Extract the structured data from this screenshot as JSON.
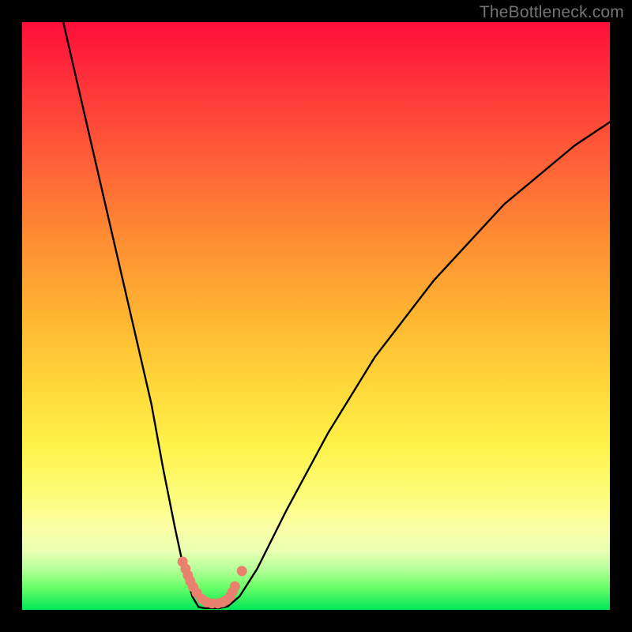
{
  "watermark": "TheBottleneck.com",
  "chart_data": {
    "type": "line",
    "title": "",
    "xlabel": "",
    "ylabel": "",
    "xlim": [
      0,
      100
    ],
    "ylim": [
      0,
      100
    ],
    "grid": false,
    "legend": false,
    "background_gradient": {
      "top": "#ff0e3a",
      "mid": "#ffd83a",
      "bottom": "#00e756"
    },
    "series": [
      {
        "name": "bottleneck-curve",
        "stroke": "#000000",
        "x": [
          7,
          10,
          13,
          16,
          19,
          22,
          24,
          26,
          27.5,
          29,
          30,
          31,
          33.5,
          35,
          37,
          40,
          45,
          52,
          60,
          70,
          82,
          94,
          100
        ],
        "values": [
          100,
          87,
          74,
          61,
          48,
          35,
          24,
          14,
          7,
          2.2,
          0.5,
          0.3,
          0.3,
          0.6,
          2.3,
          7,
          17,
          30,
          43,
          56,
          69,
          79,
          83
        ]
      },
      {
        "name": "marker-dots",
        "stroke": "#e9816f",
        "type": "scatter",
        "x": [
          27.3,
          27.8,
          28.2,
          28.6,
          29.1,
          29.7,
          30.5,
          31.4,
          32.3,
          33.3,
          34.1,
          34.8,
          35.4,
          35.8,
          36.2,
          37.4
        ],
        "values": [
          8.2,
          7.0,
          5.9,
          4.9,
          3.9,
          2.9,
          1.9,
          1.3,
          1.1,
          1.1,
          1.3,
          1.7,
          2.3,
          3.1,
          4.0,
          6.6
        ]
      }
    ]
  }
}
